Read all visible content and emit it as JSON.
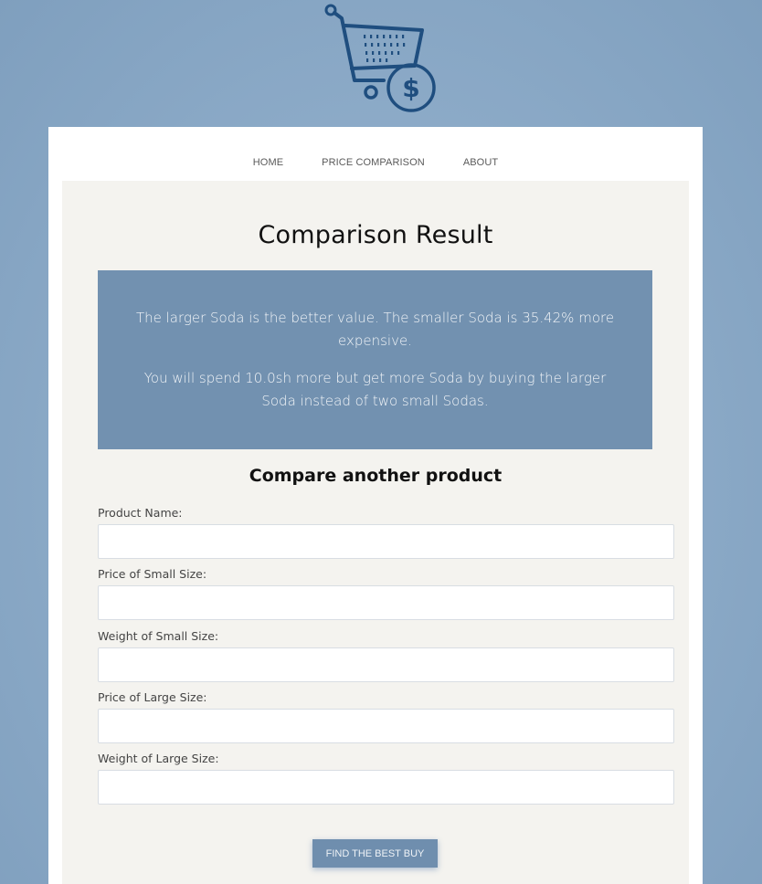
{
  "logo": {
    "icon": "shopping-cart-dollar-icon",
    "color": "#1f4e7f"
  },
  "nav": {
    "items": [
      {
        "label": "HOME"
      },
      {
        "label": "PRICE COMPARISON"
      },
      {
        "label": "ABOUT"
      }
    ]
  },
  "result": {
    "title": "Comparison Result",
    "line1": "The larger Soda is the better value. The smaller Soda is 35.42% more expensive.",
    "line2": "You will spend 10.0sh more but get more Soda by buying the larger Soda instead of two small Sodas."
  },
  "form": {
    "heading": "Compare another product",
    "fields": [
      {
        "label": "Product Name:",
        "value": ""
      },
      {
        "label": "Price of Small Size:",
        "value": ""
      },
      {
        "label": "Weight of Small Size:",
        "value": ""
      },
      {
        "label": "Price of Large Size:",
        "value": ""
      },
      {
        "label": "Weight of Large Size:",
        "value": ""
      }
    ],
    "submit_label": "FIND THE BEST BUY"
  },
  "colors": {
    "accent": "#7291b0",
    "button": "#6f8eae",
    "panel": "#f4f3ef"
  }
}
